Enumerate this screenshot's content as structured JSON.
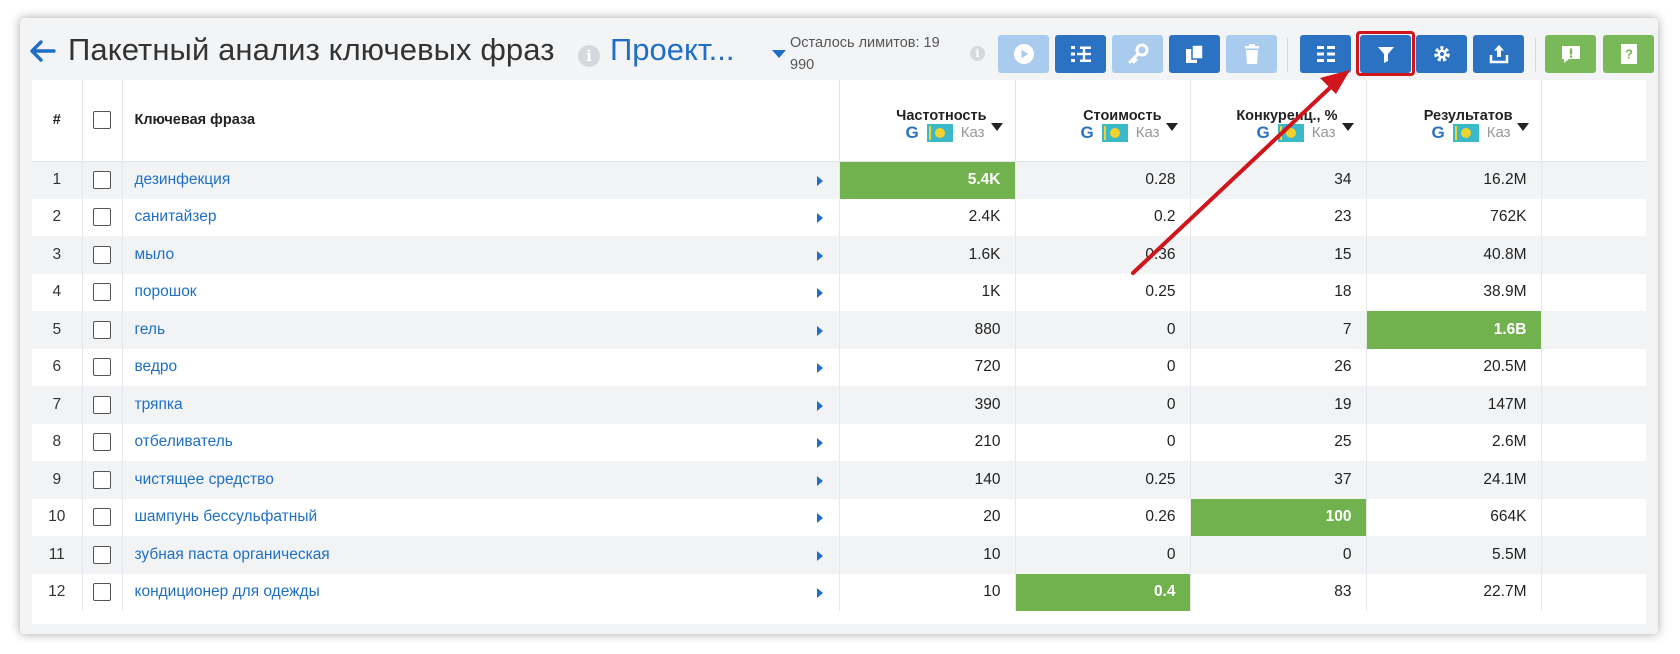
{
  "header": {
    "title": "Пакетный анализ ключевых фраз",
    "project": "Проект...",
    "limits": "Осталось лимитов: 19 990"
  },
  "toolbar": {
    "buttons": [
      {
        "name": "play-button",
        "icon": "play-icon",
        "state": "disabled"
      },
      {
        "name": "add-phrases-button",
        "icon": "add-list-icon",
        "state": "active"
      },
      {
        "name": "key-button",
        "icon": "key-icon",
        "state": "disabled"
      },
      {
        "name": "copy-button",
        "icon": "copy-icon",
        "state": "active"
      },
      {
        "name": "delete-button",
        "icon": "trash-icon",
        "state": "disabled"
      },
      {
        "name": "columns-button",
        "icon": "list-icon",
        "state": "active"
      },
      {
        "name": "filter-button",
        "icon": "filter-icon",
        "state": "active",
        "highlighted": true
      },
      {
        "name": "settings-button",
        "icon": "gear-icon",
        "state": "active"
      },
      {
        "name": "export-button",
        "icon": "upload-icon",
        "state": "active"
      },
      {
        "name": "report-button",
        "icon": "alert-message-icon",
        "state": "active"
      },
      {
        "name": "help-button",
        "icon": "help-book-icon",
        "state": "active"
      }
    ]
  },
  "table": {
    "headers": {
      "num": "#",
      "phrase": "Ключевая фраза",
      "metrics": [
        {
          "label": "Частотность",
          "region": "Каз"
        },
        {
          "label": "Стоимость",
          "region": "Каз"
        },
        {
          "label": "Конкуренц., %",
          "region": "Каз"
        },
        {
          "label": "Результатов",
          "region": "Каз"
        }
      ]
    },
    "rows": [
      {
        "num": "1",
        "phrase": "дезинфекция",
        "freq": "5.4K",
        "cost": "0.28",
        "comp": "34",
        "results": "16.2M",
        "hl": "freq"
      },
      {
        "num": "2",
        "phrase": "санитайзер",
        "freq": "2.4K",
        "cost": "0.2",
        "comp": "23",
        "results": "762K",
        "hl": ""
      },
      {
        "num": "3",
        "phrase": "мыло",
        "freq": "1.6K",
        "cost": "0.36",
        "comp": "15",
        "results": "40.8M",
        "hl": ""
      },
      {
        "num": "4",
        "phrase": "порошок",
        "freq": "1K",
        "cost": "0.25",
        "comp": "18",
        "results": "38.9M",
        "hl": ""
      },
      {
        "num": "5",
        "phrase": "гель",
        "freq": "880",
        "cost": "0",
        "comp": "7",
        "results": "1.6B",
        "hl": "results"
      },
      {
        "num": "6",
        "phrase": "ведро",
        "freq": "720",
        "cost": "0",
        "comp": "26",
        "results": "20.5M",
        "hl": ""
      },
      {
        "num": "7",
        "phrase": "тряпка",
        "freq": "390",
        "cost": "0",
        "comp": "19",
        "results": "147M",
        "hl": ""
      },
      {
        "num": "8",
        "phrase": "отбеливатель",
        "freq": "210",
        "cost": "0",
        "comp": "25",
        "results": "2.6M",
        "hl": ""
      },
      {
        "num": "9",
        "phrase": "чистящее средство",
        "freq": "140",
        "cost": "0.25",
        "comp": "37",
        "results": "24.1M",
        "hl": ""
      },
      {
        "num": "10",
        "phrase": "шампунь бессульфатный",
        "freq": "20",
        "cost": "0.26",
        "comp": "100",
        "results": "664K",
        "hl": "comp"
      },
      {
        "num": "11",
        "phrase": "зубная паста органическая",
        "freq": "10",
        "cost": "0",
        "comp": "0",
        "results": "5.5M",
        "hl": ""
      },
      {
        "num": "12",
        "phrase": "кондиционер для одежды",
        "freq": "10",
        "cost": "0.4",
        "comp": "83",
        "results": "22.7M",
        "hl": "cost"
      }
    ]
  },
  "colors": {
    "accent_blue": "#2b72c2",
    "disabled_blue": "#a9cbed",
    "green": "#79b95a",
    "highlight_cell": "#71b14e",
    "annotation_red": "#d0151c",
    "link_blue": "#1f6fc5"
  }
}
